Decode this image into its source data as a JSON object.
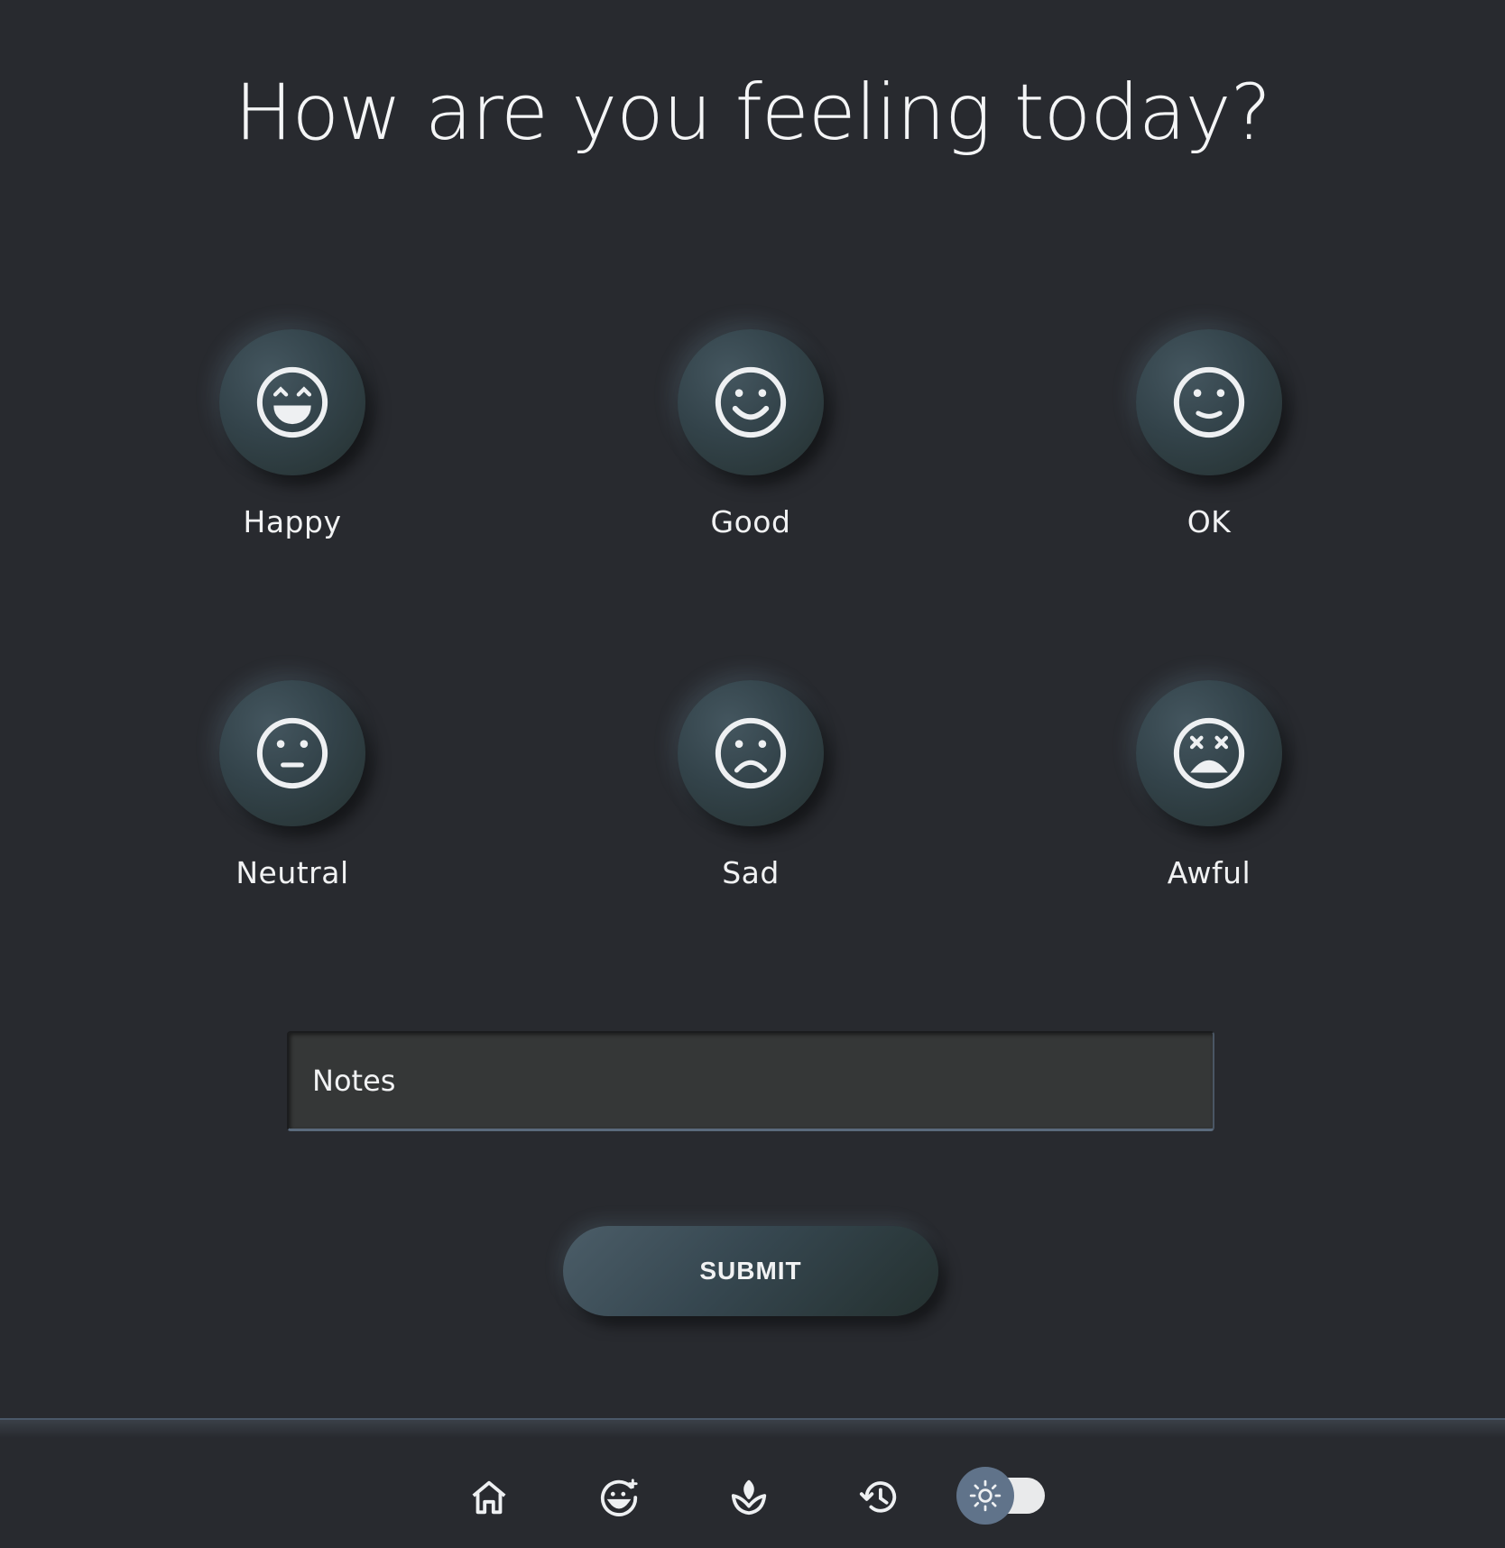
{
  "title": "How are you feeling today?",
  "moods": [
    {
      "label": "Happy",
      "icon": "grinning-face-icon"
    },
    {
      "label": "Good",
      "icon": "smiling-face-icon"
    },
    {
      "label": "OK",
      "icon": "slightly-smiling-face-icon"
    },
    {
      "label": "Neutral",
      "icon": "neutral-face-icon"
    },
    {
      "label": "Sad",
      "icon": "frowning-face-icon"
    },
    {
      "label": "Awful",
      "icon": "dizzy-face-icon"
    }
  ],
  "notes": {
    "placeholder": "Notes",
    "value": ""
  },
  "submit_label": "SUBMIT",
  "nav": {
    "items": [
      {
        "icon": "home-icon"
      },
      {
        "icon": "mood-log-icon"
      },
      {
        "icon": "self-care-icon"
      },
      {
        "icon": "history-icon"
      }
    ],
    "theme_toggle_icon": "sun-icon"
  },
  "colors": {
    "background": "#282a2f",
    "button": "#33434a",
    "toggle_knob": "#60738a",
    "text": "#eef0f2"
  }
}
